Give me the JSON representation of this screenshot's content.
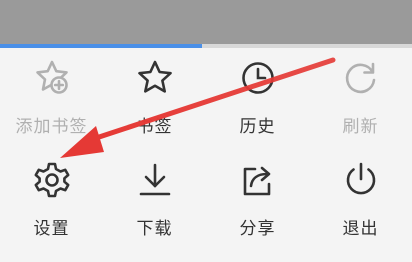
{
  "progress": {
    "fraction": 0.49
  },
  "menu": {
    "items": [
      {
        "label": "添加书签",
        "icon": "add-bookmark-icon",
        "enabled": false
      },
      {
        "label": "书签",
        "icon": "star-icon",
        "enabled": true
      },
      {
        "label": "历史",
        "icon": "clock-icon",
        "enabled": true
      },
      {
        "label": "刷新",
        "icon": "refresh-icon",
        "enabled": false
      },
      {
        "label": "设置",
        "icon": "gear-icon",
        "enabled": true
      },
      {
        "label": "下载",
        "icon": "download-icon",
        "enabled": true
      },
      {
        "label": "分享",
        "icon": "share-icon",
        "enabled": true
      },
      {
        "label": "退出",
        "icon": "power-icon",
        "enabled": true
      }
    ]
  },
  "colors": {
    "top_bar": "#9a9a9a",
    "progress": "#4a8fe7",
    "panel": "#f4f4f4",
    "icon": "#333333",
    "icon_disabled": "#b0b0b0",
    "annotation_arrow": "#e53935"
  }
}
